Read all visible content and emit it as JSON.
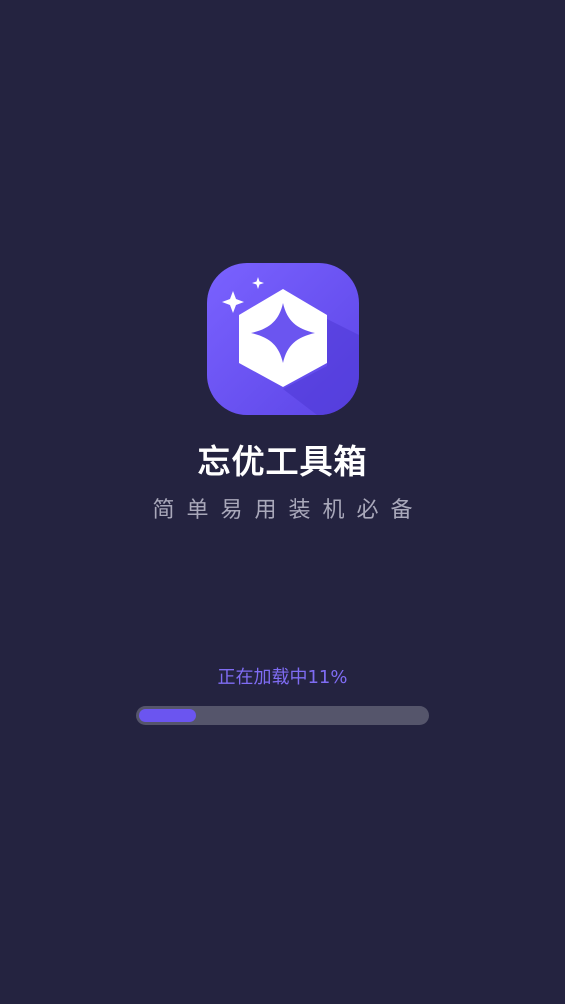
{
  "app": {
    "name": "忘优工具箱",
    "slogan": "简单易用装机必备",
    "logo_icon": "sparkle-box-icon"
  },
  "loading": {
    "label": "正在加载中11%",
    "progress_percent": 11
  },
  "colors": {
    "background": "#242340",
    "accent": "#6b55f0",
    "loading_text": "#7f6cf3",
    "track": "#55556b"
  }
}
